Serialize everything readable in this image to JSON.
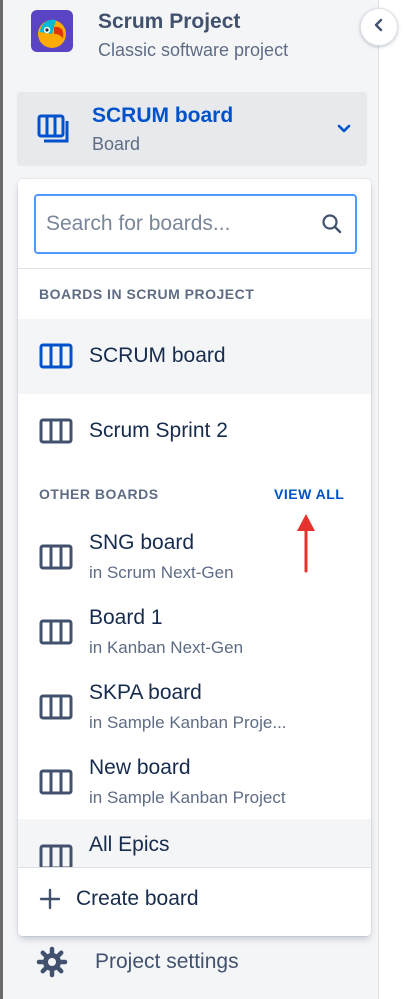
{
  "project": {
    "name": "Scrum Project",
    "type": "Classic software project",
    "avatar_icon": "parrot-avatar-icon"
  },
  "board_selector": {
    "name": "SCRUM board",
    "type": "Board",
    "icon": "board-icon",
    "chevron": "chevron-down-icon"
  },
  "dropdown": {
    "search": {
      "placeholder": "Search for boards...",
      "value": ""
    },
    "project_section": {
      "heading": "BOARDS IN SCRUM PROJECT",
      "items": [
        {
          "name": "SCRUM board",
          "selected": true
        },
        {
          "name": "Scrum Sprint 2",
          "selected": false
        }
      ]
    },
    "other_section": {
      "heading": "OTHER BOARDS",
      "view_all": "VIEW ALL",
      "items": [
        {
          "name": "SNG board",
          "sub": "in Scrum Next-Gen"
        },
        {
          "name": "Board 1",
          "sub": "in Kanban Next-Gen"
        },
        {
          "name": "SKPA board",
          "sub": "in Sample Kanban Proje..."
        },
        {
          "name": "New board",
          "sub": "in Sample Kanban Project"
        },
        {
          "name": "All Epics",
          "sub": ""
        }
      ]
    },
    "create": {
      "label": "Create board",
      "icon": "plus-icon"
    }
  },
  "settings": {
    "label": "Project settings",
    "icon": "gear-icon"
  },
  "annotation": {
    "icon": "red-arrow-icon",
    "color": "#e5322d"
  },
  "colors": {
    "accent": "#0052cc",
    "text": "#172b4d",
    "subtle": "#5e6c84",
    "sidebar_bg": "#f4f5f7",
    "focus": "#4c9aff"
  }
}
